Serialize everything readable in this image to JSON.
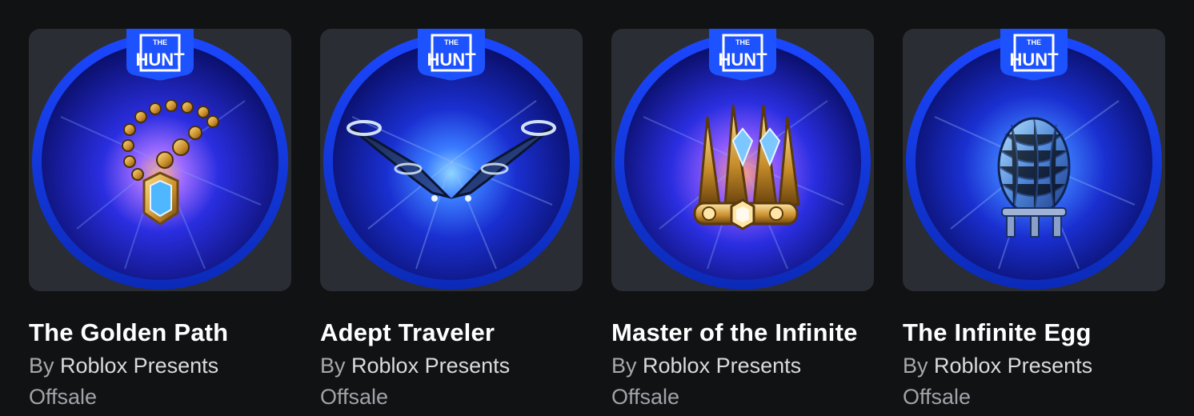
{
  "items": [
    {
      "title": "The Golden Path",
      "by_label": "By",
      "creator": "Roblox Presents",
      "status": "Offsale",
      "badge_top": "THE",
      "badge_main": "HUNT",
      "icon": "golden-necklace-icon",
      "glow": "#ff9a70"
    },
    {
      "title": "Adept Traveler",
      "by_label": "By",
      "creator": "Roblox Presents",
      "status": "Offsale",
      "badge_top": "THE",
      "badge_main": "HUNT",
      "icon": "wings-icon",
      "glow": "#3c7dff"
    },
    {
      "title": "Master of the Infinite",
      "by_label": "By",
      "creator": "Roblox Presents",
      "status": "Offsale",
      "badge_top": "THE",
      "badge_main": "HUNT",
      "icon": "crown-icon",
      "glow": "#ff8a6a"
    },
    {
      "title": "The Infinite Egg",
      "by_label": "By",
      "creator": "Roblox Presents",
      "status": "Offsale",
      "badge_top": "THE",
      "badge_main": "HUNT",
      "icon": "egg-icon",
      "glow": "#55aaff"
    }
  ]
}
